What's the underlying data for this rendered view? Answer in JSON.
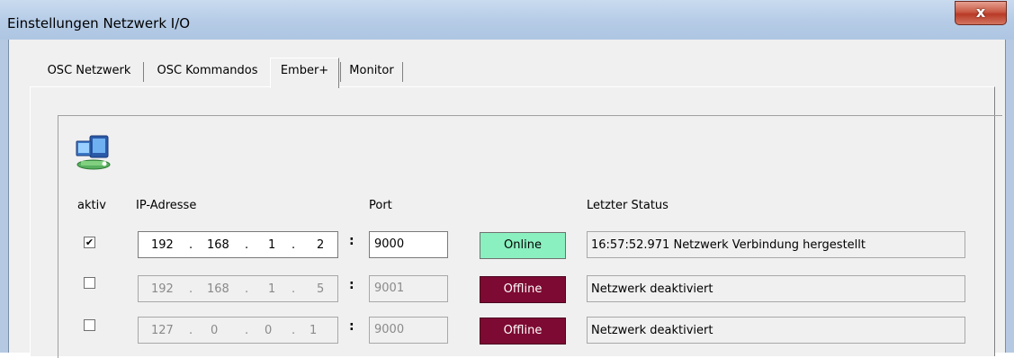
{
  "window": {
    "title": "Einstellungen Netzwerk I/O",
    "close_glyph": "x"
  },
  "tabs": [
    {
      "label": "OSC Netzwerk",
      "active": false
    },
    {
      "label": "OSC Kommandos",
      "active": false
    },
    {
      "label": "Ember+",
      "active": true
    },
    {
      "label": "Monitor",
      "active": false
    }
  ],
  "panel": {
    "icon": "network-computer-icon",
    "headers": {
      "aktiv": "aktiv",
      "ip": "IP-Adresse",
      "port": "Port",
      "status": "Letzter Status"
    },
    "separator": ":",
    "rows": [
      {
        "checked": true,
        "ip": [
          "192",
          "168",
          "1",
          "2"
        ],
        "port": "9000",
        "button": "Online",
        "button_state": "online",
        "status": "16:57:52.971  Netzwerk Verbindung hergestellt",
        "enabled": true
      },
      {
        "checked": false,
        "ip": [
          "192",
          "168",
          "1",
          "5"
        ],
        "port": "9001",
        "button": "Offline",
        "button_state": "offline",
        "status": "Netzwerk deaktiviert",
        "enabled": false
      },
      {
        "checked": false,
        "ip": [
          "127",
          "0",
          "0",
          "1"
        ],
        "port": "9000",
        "button": "Offline",
        "button_state": "offline",
        "status": "Netzwerk deaktiviert",
        "enabled": false
      }
    ]
  },
  "colors": {
    "online": "#8af0c0",
    "offline": "#7d0a32",
    "titlebar": "#b5cbe6"
  }
}
